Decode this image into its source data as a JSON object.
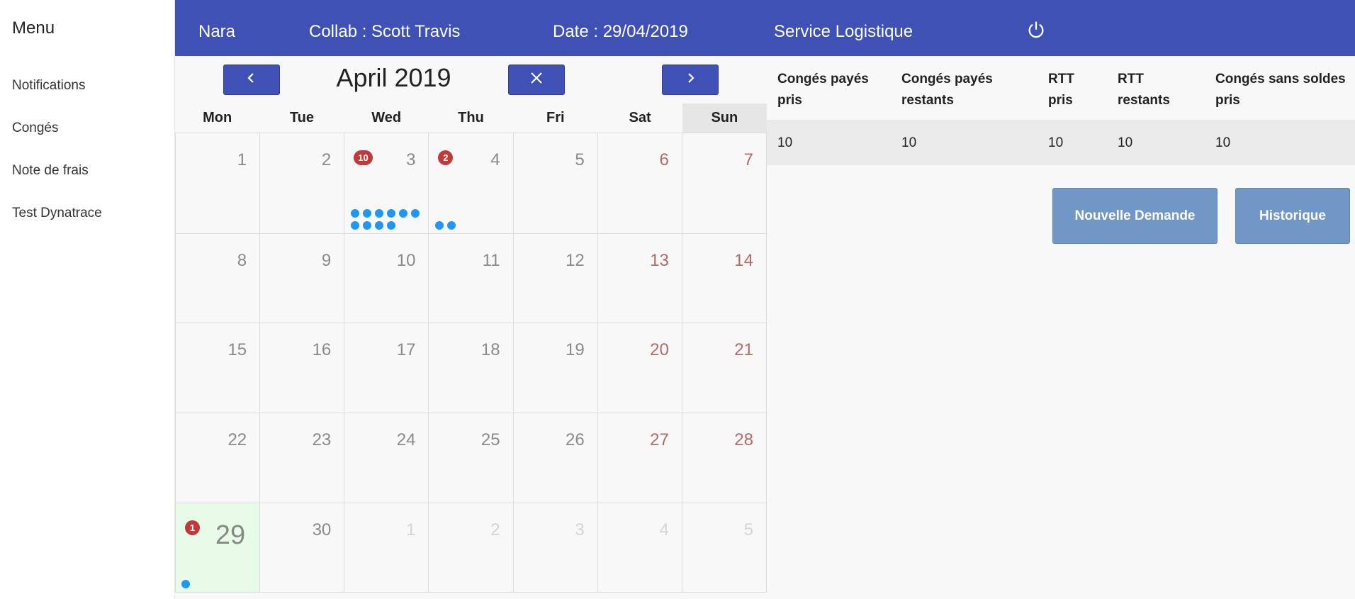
{
  "sidebar": {
    "title": "Menu",
    "items": [
      {
        "label": "Notifications"
      },
      {
        "label": "Congés"
      },
      {
        "label": "Note de frais"
      },
      {
        "label": "Test Dynatrace"
      }
    ]
  },
  "header": {
    "app_name": "Nara",
    "collab": "Collab : Scott Travis",
    "date": "Date : 29/04/2019",
    "service": "Service Logistique",
    "power_icon": "power-icon",
    "background": "#3f51b5"
  },
  "calendar": {
    "title": "April 2019",
    "prev_icon": "chevron-left-icon",
    "close_icon": "close-icon",
    "next_icon": "chevron-right-icon",
    "weekdays": [
      "Mon",
      "Tue",
      "Wed",
      "Thu",
      "Fri",
      "Sat",
      "Sun"
    ],
    "weeks": [
      [
        {
          "day": "1"
        },
        {
          "day": "2"
        },
        {
          "day": "3",
          "badge": "10",
          "dots": 10
        },
        {
          "day": "4",
          "badge": "2",
          "dots": 2
        },
        {
          "day": "5"
        },
        {
          "day": "6",
          "weekend": true
        },
        {
          "day": "7",
          "weekend": true
        }
      ],
      [
        {
          "day": "8"
        },
        {
          "day": "9"
        },
        {
          "day": "10"
        },
        {
          "day": "11"
        },
        {
          "day": "12"
        },
        {
          "day": "13",
          "weekend": true
        },
        {
          "day": "14",
          "weekend": true
        }
      ],
      [
        {
          "day": "15"
        },
        {
          "day": "16"
        },
        {
          "day": "17"
        },
        {
          "day": "18"
        },
        {
          "day": "19"
        },
        {
          "day": "20",
          "weekend": true
        },
        {
          "day": "21",
          "weekend": true
        }
      ],
      [
        {
          "day": "22"
        },
        {
          "day": "23"
        },
        {
          "day": "24"
        },
        {
          "day": "25"
        },
        {
          "day": "26"
        },
        {
          "day": "27",
          "weekend": true
        },
        {
          "day": "28",
          "weekend": true
        }
      ],
      [
        {
          "day": "29",
          "today": true,
          "badge": "1",
          "dots": 1
        },
        {
          "day": "30"
        },
        {
          "day": "1",
          "other": true
        },
        {
          "day": "2",
          "other": true
        },
        {
          "day": "3",
          "other": true
        },
        {
          "day": "4",
          "other": true
        },
        {
          "day": "5",
          "other": true
        }
      ]
    ],
    "colors": {
      "badge": "#c0393b",
      "dot": "#2196f3",
      "today_bg": "#e8fbe8",
      "weekend_text": "#b56a6a"
    }
  },
  "balance": {
    "headers": [
      "Congés payés pris",
      "Congés payés restants",
      "RTT pris",
      "RTT restants",
      "Congés sans soldes pris"
    ],
    "values": [
      "10",
      "10",
      "10",
      "10",
      "10"
    ]
  },
  "actions": {
    "new_request": "Nouvelle Demande",
    "history": "Historique",
    "button_color": "#7097c6"
  }
}
